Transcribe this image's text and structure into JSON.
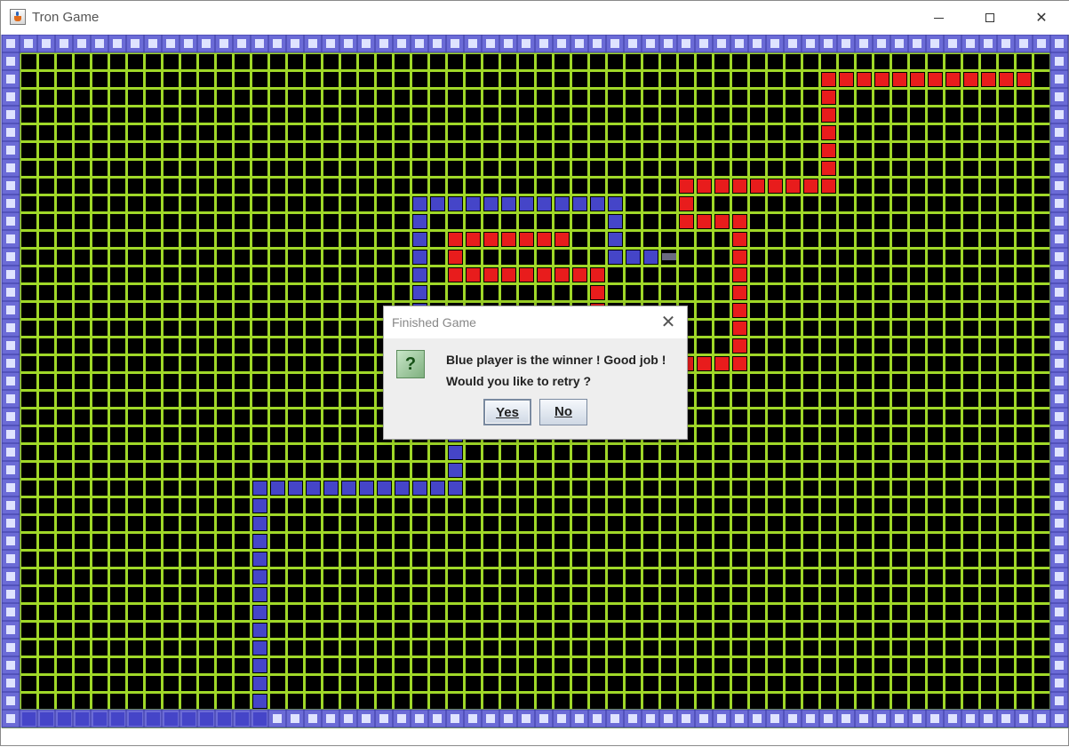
{
  "window": {
    "title": "Tron Game",
    "controls": [
      "minimize",
      "maximize",
      "close"
    ]
  },
  "board": {
    "cols": 60,
    "rows": 39,
    "colors": {
      "background": "#000000",
      "grid": "#a0d828",
      "wall": "#6b6bd6",
      "blue_trail": "#4545c8",
      "red_trail": "#e81c1c",
      "blue_head": "#6a6a80"
    },
    "blue_trail": [
      [
        1,
        38
      ],
      [
        2,
        38
      ],
      [
        3,
        38
      ],
      [
        4,
        38
      ],
      [
        5,
        38
      ],
      [
        6,
        38
      ],
      [
        7,
        38
      ],
      [
        8,
        38
      ],
      [
        9,
        38
      ],
      [
        10,
        38
      ],
      [
        11,
        38
      ],
      [
        12,
        38
      ],
      [
        13,
        38
      ],
      [
        14,
        38
      ],
      [
        14,
        37
      ],
      [
        14,
        36
      ],
      [
        14,
        35
      ],
      [
        14,
        34
      ],
      [
        14,
        33
      ],
      [
        14,
        32
      ],
      [
        14,
        31
      ],
      [
        14,
        30
      ],
      [
        14,
        29
      ],
      [
        14,
        28
      ],
      [
        14,
        27
      ],
      [
        14,
        26
      ],
      [
        14,
        25
      ],
      [
        15,
        25
      ],
      [
        16,
        25
      ],
      [
        17,
        25
      ],
      [
        18,
        25
      ],
      [
        19,
        25
      ],
      [
        20,
        25
      ],
      [
        21,
        25
      ],
      [
        22,
        25
      ],
      [
        23,
        25
      ],
      [
        24,
        25
      ],
      [
        25,
        25
      ],
      [
        25,
        24
      ],
      [
        25,
        23
      ],
      [
        25,
        22
      ],
      [
        23,
        15
      ],
      [
        23,
        14
      ],
      [
        23,
        13
      ],
      [
        23,
        12
      ],
      [
        23,
        11
      ],
      [
        23,
        10
      ],
      [
        23,
        9
      ],
      [
        24,
        9
      ],
      [
        25,
        9
      ],
      [
        26,
        9
      ],
      [
        27,
        9
      ],
      [
        28,
        9
      ],
      [
        29,
        9
      ],
      [
        30,
        9
      ],
      [
        31,
        9
      ],
      [
        32,
        9
      ],
      [
        33,
        9
      ],
      [
        34,
        9
      ],
      [
        34,
        10
      ],
      [
        34,
        11
      ],
      [
        34,
        12
      ],
      [
        35,
        12
      ],
      [
        36,
        12
      ]
    ],
    "blue_head": [
      37,
      12
    ],
    "red_trail": [
      [
        57,
        2
      ],
      [
        56,
        2
      ],
      [
        55,
        2
      ],
      [
        54,
        2
      ],
      [
        53,
        2
      ],
      [
        52,
        2
      ],
      [
        51,
        2
      ],
      [
        50,
        2
      ],
      [
        49,
        2
      ],
      [
        48,
        2
      ],
      [
        47,
        2
      ],
      [
        46,
        2
      ],
      [
        46,
        3
      ],
      [
        46,
        4
      ],
      [
        46,
        5
      ],
      [
        46,
        6
      ],
      [
        46,
        7
      ],
      [
        46,
        8
      ],
      [
        45,
        8
      ],
      [
        44,
        8
      ],
      [
        43,
        8
      ],
      [
        42,
        8
      ],
      [
        41,
        8
      ],
      [
        40,
        8
      ],
      [
        39,
        8
      ],
      [
        38,
        8
      ],
      [
        38,
        9
      ],
      [
        38,
        10
      ],
      [
        39,
        10
      ],
      [
        40,
        10
      ],
      [
        41,
        10
      ],
      [
        41,
        11
      ],
      [
        41,
        12
      ],
      [
        41,
        13
      ],
      [
        41,
        14
      ],
      [
        41,
        15
      ],
      [
        41,
        16
      ],
      [
        41,
        17
      ],
      [
        41,
        18
      ],
      [
        40,
        18
      ],
      [
        39,
        18
      ],
      [
        38,
        18
      ],
      [
        25,
        11
      ],
      [
        26,
        11
      ],
      [
        27,
        11
      ],
      [
        28,
        11
      ],
      [
        29,
        11
      ],
      [
        30,
        11
      ],
      [
        31,
        11
      ],
      [
        25,
        12
      ],
      [
        25,
        13
      ],
      [
        26,
        13
      ],
      [
        27,
        13
      ],
      [
        28,
        13
      ],
      [
        29,
        13
      ],
      [
        30,
        13
      ],
      [
        31,
        13
      ],
      [
        32,
        13
      ],
      [
        33,
        13
      ],
      [
        33,
        14
      ],
      [
        33,
        15
      ]
    ]
  },
  "dialog": {
    "title": "Finished Game",
    "icon": "question-icon",
    "message_line1": "Blue player is the winner ! Good job !",
    "message_line2": "Would you like to retry ?",
    "yes_label": "Yes",
    "no_label": "No"
  }
}
